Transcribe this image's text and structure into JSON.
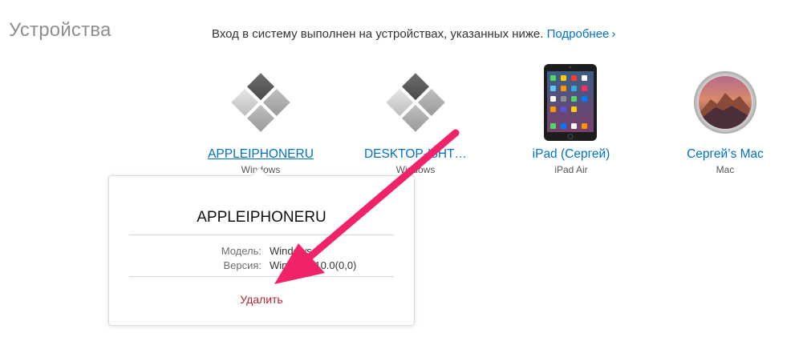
{
  "section": {
    "title": "Устройства"
  },
  "intro": {
    "text": "Вход в систему выполнен на устройствах, указанных ниже.",
    "link": "Подробнее",
    "chevron": "›"
  },
  "devices": [
    {
      "name": "APPLEIPHONERU",
      "type": "Windows",
      "icon": "windows-icon"
    },
    {
      "name": "DESKTOP-I5HT…",
      "type": "Windows",
      "icon": "windows-icon"
    },
    {
      "name": "iPad (Сергей)",
      "type": "iPad Air",
      "icon": "ipad-icon"
    },
    {
      "name": "Сергей’s Mac",
      "type": "Mac",
      "icon": "mac-icon"
    }
  ],
  "popover": {
    "title": "APPLEIPHONERU",
    "model_label": "Модель:",
    "model_value": "Windows",
    "version_label": "Версия:",
    "version_value": "Windows 10.0(0,0)",
    "delete_label": "Удалить"
  },
  "colors": {
    "link": "#0070c9",
    "delete": "#b5272d",
    "annotation_arrow": "#f0226a"
  }
}
